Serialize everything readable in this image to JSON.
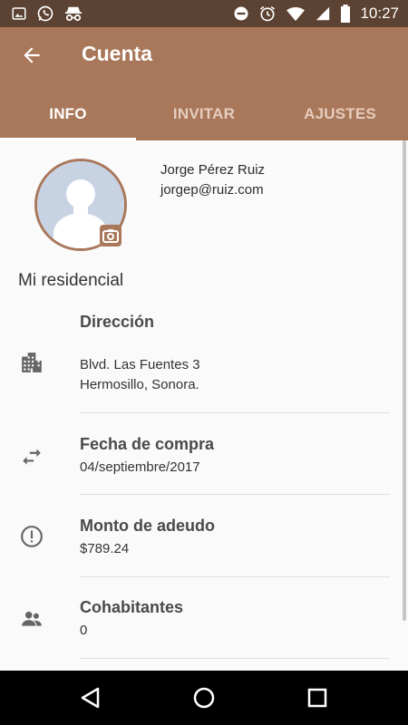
{
  "status_bar": {
    "time": "10:27",
    "left_icons": [
      "gallery-icon",
      "whatsapp-icon",
      "incognito-icon"
    ],
    "right_icons": [
      "do-not-disturb-icon",
      "alarm-icon",
      "wifi-icon",
      "signal-icon",
      "battery-icon"
    ]
  },
  "app_bar": {
    "title": "Cuenta",
    "tabs": [
      {
        "label": "INFO",
        "active": true
      },
      {
        "label": "INVITAR",
        "active": false
      },
      {
        "label": "AJUSTES",
        "active": false
      }
    ]
  },
  "profile": {
    "name": "Jorge Pérez Ruiz",
    "email": "jorgep@ruiz.com"
  },
  "section_title": "Mi residencial",
  "rows": [
    {
      "title": "Dirección",
      "line1": "Blvd. Las Fuentes 3",
      "line2": "Hermosillo, Sonora."
    },
    {
      "title": "Fecha de compra",
      "value": "04/septiembre/2017"
    },
    {
      "title": "Monto de adeudo",
      "value": "$789.24"
    },
    {
      "title": "Cohabitantes",
      "value": "0"
    }
  ],
  "colors": {
    "primary": "#a9775a",
    "status_bar": "#5b4232",
    "background": "#fafafa"
  }
}
